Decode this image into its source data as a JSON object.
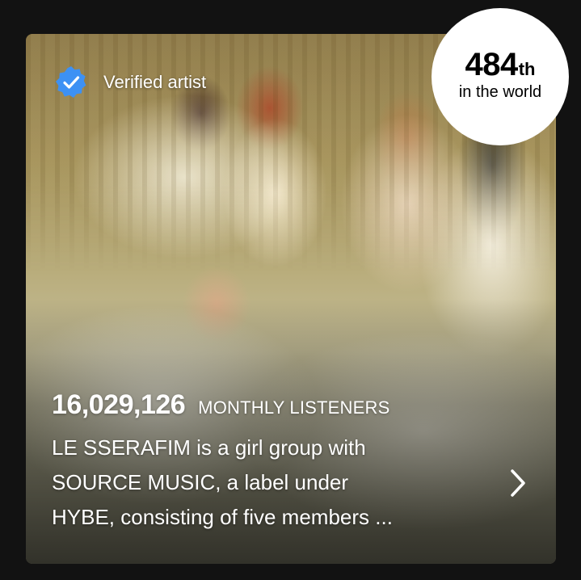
{
  "artist_card": {
    "verified_label": "Verified artist",
    "verified_icon": "verified-badge-icon",
    "accent_color": "#3d91f4",
    "rank": {
      "number": "484",
      "suffix": "th",
      "caption": "in the world"
    },
    "monthly_listeners": {
      "count": "16,029,126",
      "label": "MONTHLY LISTENERS"
    },
    "bio_lines": [
      "LE SSERAFIM is a girl group with",
      "SOURCE MUSIC, a label under",
      "HYBE, consisting of five members ..."
    ],
    "more_icon": "chevron-right-icon"
  }
}
